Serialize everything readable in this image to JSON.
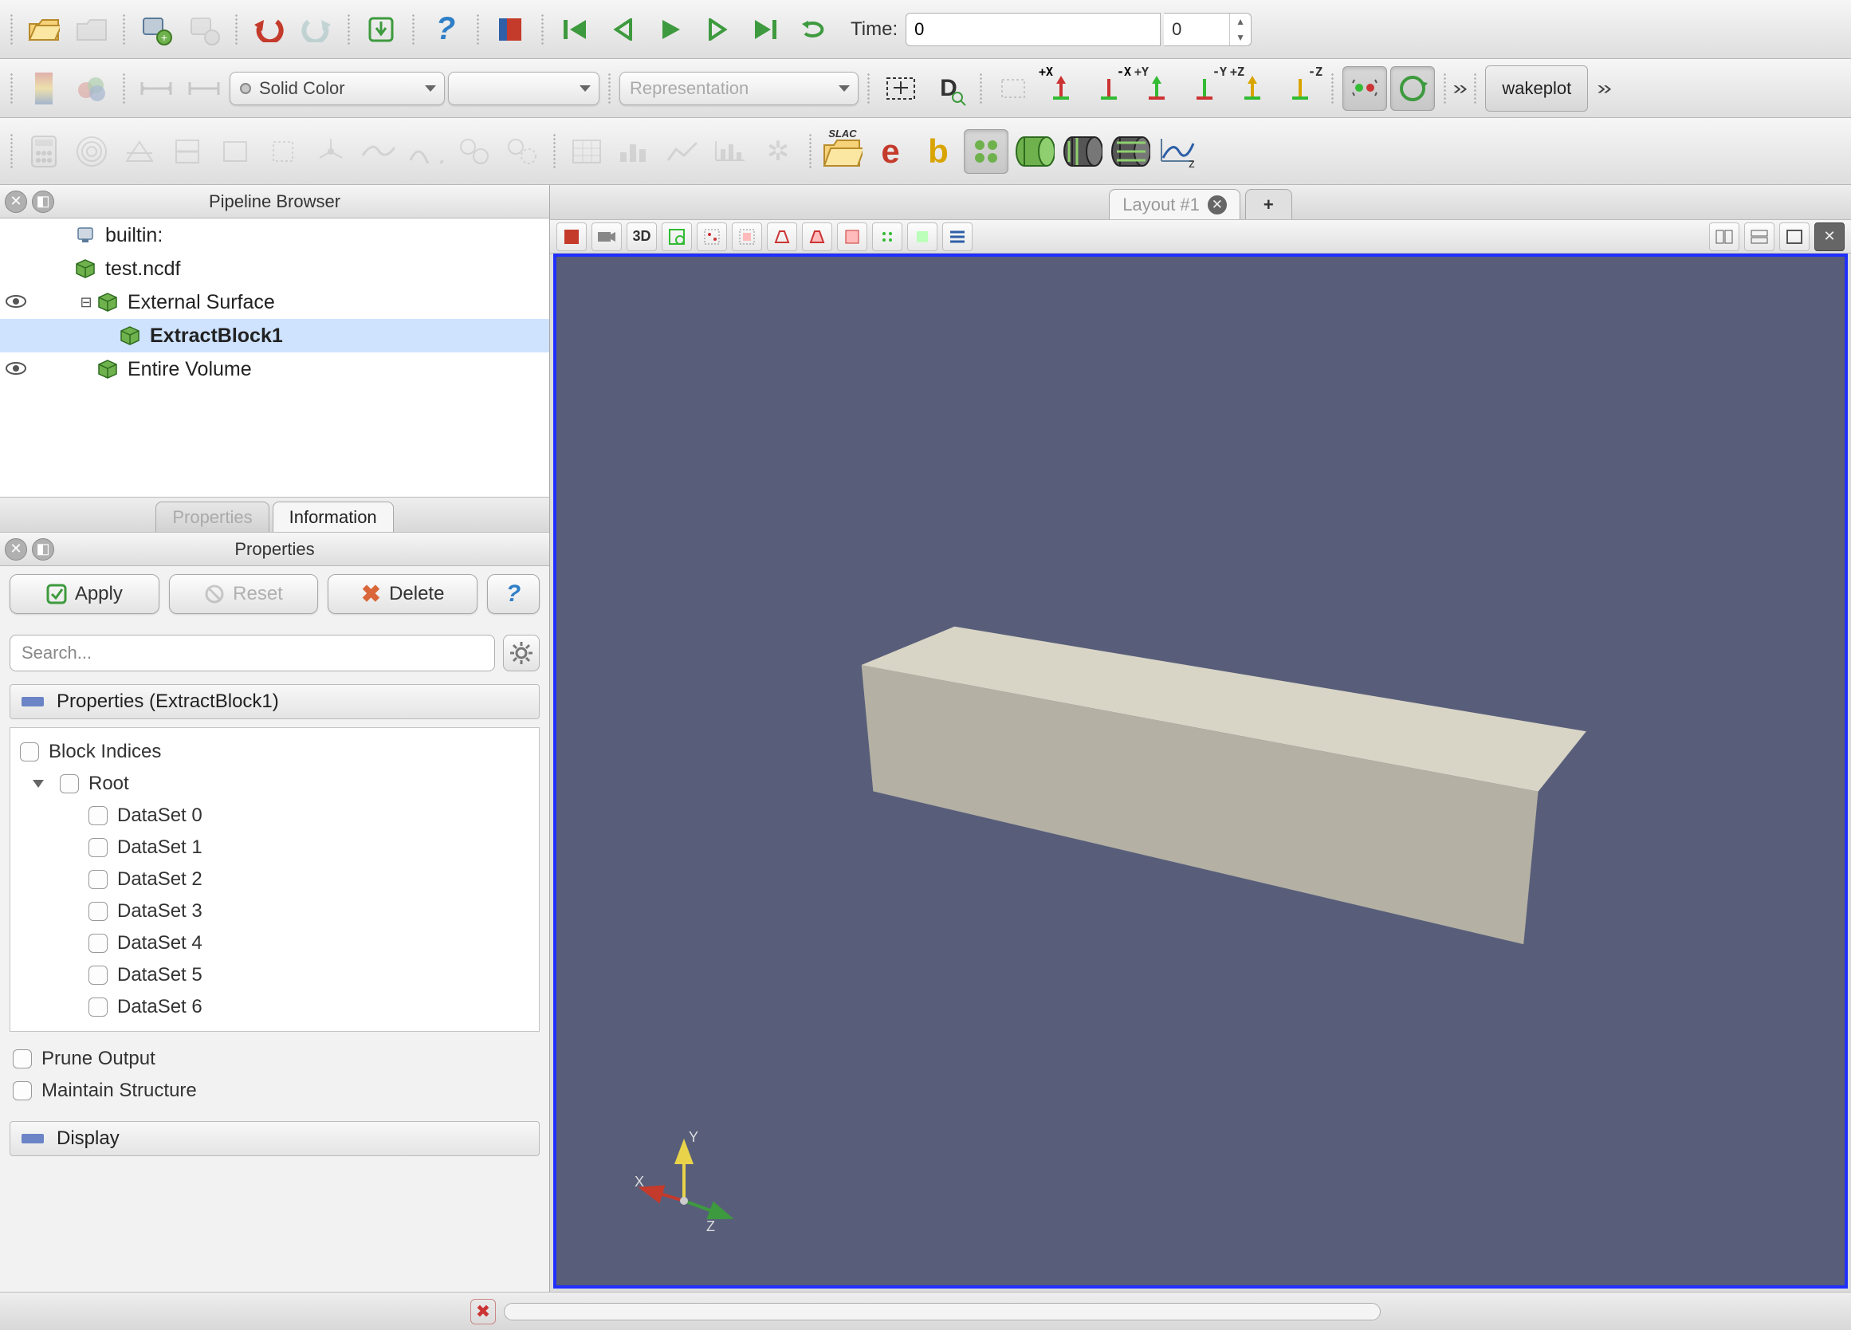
{
  "time": {
    "label": "Time:",
    "current": "0",
    "frame": "0"
  },
  "combo": {
    "coloring": "Solid Color",
    "component": "",
    "representation": "Representation"
  },
  "macro": {
    "name": "wakeplot"
  },
  "axisButtons": [
    "+X",
    "-X",
    "+Y",
    "-Y",
    "+Z",
    "-Z"
  ],
  "pipeline": {
    "title": "Pipeline Browser",
    "items": [
      {
        "label": "builtin:",
        "icon": "server",
        "indent": 1,
        "eye": false,
        "expander": ""
      },
      {
        "label": "test.ncdf",
        "icon": "cube",
        "indent": 1,
        "eye": false,
        "expander": ""
      },
      {
        "label": "External Surface",
        "icon": "cube",
        "indent": 2,
        "eye": true,
        "expander": "⊟"
      },
      {
        "label": "ExtractBlock1",
        "icon": "cube",
        "indent": 3,
        "eye": false,
        "expander": "",
        "selected": true,
        "bold": true
      },
      {
        "label": "Entire Volume",
        "icon": "cube",
        "indent": 2,
        "eye": true,
        "expander": ""
      }
    ]
  },
  "tabs": {
    "properties": "Properties",
    "information": "Information"
  },
  "props": {
    "title": "Properties",
    "apply": "Apply",
    "reset": "Reset",
    "delete": "Delete",
    "searchPlaceholder": "Search...",
    "sectionTitle": "Properties (ExtractBlock1)",
    "blockIndices": "Block Indices",
    "root": "Root",
    "datasets": [
      "DataSet 0",
      "DataSet 1",
      "DataSet 2",
      "DataSet 3",
      "DataSet 4",
      "DataSet 5",
      "DataSet 6"
    ],
    "pruneOutput": "Prune Output",
    "maintainStructure": "Maintain Structure",
    "displaySection": "Display"
  },
  "layout": {
    "tab1": "Layout #1"
  },
  "viewToolbar": {
    "mode3d": "3D"
  },
  "axes": {
    "x": "X",
    "y": "Y",
    "z": "Z"
  }
}
